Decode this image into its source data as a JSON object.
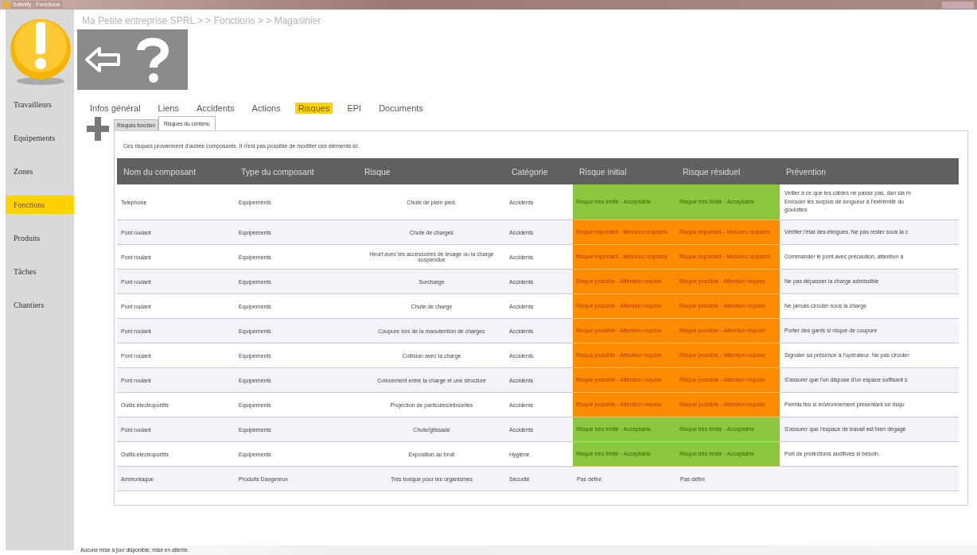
{
  "window": {
    "title": "Safetify : Fonctions"
  },
  "sidebar": {
    "items": [
      {
        "label": "Travailleurs",
        "selected": false
      },
      {
        "label": "Equipements",
        "selected": false
      },
      {
        "label": "Zones",
        "selected": false
      },
      {
        "label": "Fonctions",
        "selected": true
      },
      {
        "label": "Produits",
        "selected": false
      },
      {
        "label": "Tâches",
        "selected": false
      },
      {
        "label": "Chantiers",
        "selected": false
      }
    ]
  },
  "breadcrumb": "Ma Petite entreprise SPRL > > Fonctions > > Magasinier",
  "tabs": [
    {
      "label": "Infos général",
      "selected": false
    },
    {
      "label": "Liens",
      "selected": false
    },
    {
      "label": "Accidents",
      "selected": false
    },
    {
      "label": "Actions",
      "selected": false
    },
    {
      "label": "Risques",
      "selected": true
    },
    {
      "label": "EPI",
      "selected": false
    },
    {
      "label": "Documents",
      "selected": false
    }
  ],
  "subtabs": [
    {
      "label": "Risques fonction",
      "selected": false
    },
    {
      "label": "Risques du contenu",
      "selected": true
    }
  ],
  "note": "Ces risques proviennent d'autres composants. Il n'est pas possible de modifier ces éléments ici.",
  "table": {
    "columns": [
      "Nom du composant",
      "Type du composant",
      "Risque",
      "Catégorie",
      "Risque initial",
      "Risque résiduel",
      "Prévention"
    ],
    "rows": [
      {
        "name": "Telephone",
        "type": "Equipements",
        "risk": "Chute de plein pied.",
        "category": "Accidents",
        "initial": {
          "kind": "low",
          "text": "Risque très limité - Acceptable"
        },
        "residual": {
          "kind": "low",
          "text": "Risque très limité - Acceptable"
        },
        "prevention": "Veiller à ce que les câbles ne passe pas, dan sla m\nEnrouler les surplus de longueur à l'extrémité du\ngoulottes"
      },
      {
        "name": "Pont roulant",
        "type": "Equipements",
        "risk": "Chute de charges",
        "category": "Accidents",
        "initial": {
          "kind": "important",
          "text": "Risque important - Mesures requises"
        },
        "residual": {
          "kind": "important",
          "text": "Risque important - Mesures requises"
        },
        "prevention": "Vérifier l'état des élingues. Ne pas rester sous la c"
      },
      {
        "name": "Pont roulant",
        "type": "Equipements",
        "risk": "Heurt avec les accessoires de levage ou la charge suspendue",
        "category": "Accidents",
        "initial": {
          "kind": "important",
          "text": "Risque important - Mesures requises"
        },
        "residual": {
          "kind": "important",
          "text": "Risque important - Mesures requises"
        },
        "prevention": "Commander le pont avec précaution, attention a"
      },
      {
        "name": "Pont roulant",
        "type": "Equipements",
        "risk": "Surcharge",
        "category": "Accidents",
        "initial": {
          "kind": "possible",
          "text": "Risque possible - Attention requise"
        },
        "residual": {
          "kind": "possible",
          "text": "Risque possible - Attention requise"
        },
        "prevention": "Ne pas dépasser la charge admissible"
      },
      {
        "name": "Pont roulant",
        "type": "Equipements",
        "risk": "Chute de charge",
        "category": "Accidents",
        "initial": {
          "kind": "possible",
          "text": "Risque possible - Attention requise"
        },
        "residual": {
          "kind": "possible",
          "text": "Risque possible - Attention requise"
        },
        "prevention": "Ne jamais circuler sous la charge"
      },
      {
        "name": "Pont roulant",
        "type": "Equipements",
        "risk": "Coupure lors de la manutention de charges",
        "category": "Accidents",
        "initial": {
          "kind": "possible",
          "text": "Risque possible - Attention requise"
        },
        "residual": {
          "kind": "possible",
          "text": "Risque possible - Attention requise"
        },
        "prevention": "Porter des gants si risque de coupure"
      },
      {
        "name": "Pont roulant",
        "type": "Equipements",
        "risk": "Collision avec la charge",
        "category": "Accidents",
        "initial": {
          "kind": "possible",
          "text": "Risque possible - Attention requise"
        },
        "residual": {
          "kind": "possible",
          "text": "Risque possible - Attention requise"
        },
        "prevention": "Signaler sa présence à l'opérateur. Ne pas circuler"
      },
      {
        "name": "Pont roulant",
        "type": "Equipements",
        "risk": "Coincement entre la charge et une structure",
        "category": "Accidents",
        "initial": {
          "kind": "possible",
          "text": "Risque possible - Attention requise"
        },
        "residual": {
          "kind": "possible",
          "text": "Risque possible - Attention requise"
        },
        "prevention": "S'assurer que l'on dispose d'un espace suffisant s"
      },
      {
        "name": "Outils électroportifs",
        "type": "Equipements",
        "risk": "Projection de particules/étincelles",
        "category": "Accidents",
        "initial": {
          "kind": "possible",
          "text": "Risque possible - Attention requise"
        },
        "residual": {
          "kind": "possible",
          "text": "Risque possible - Attention requise"
        },
        "prevention": "Permis feu si environnement présentant un risqu"
      },
      {
        "name": "Pont roulant",
        "type": "Equipements",
        "risk": "Chute/glissade",
        "category": "Accidents",
        "initial": {
          "kind": "low",
          "text": "Risque très limité - Acceptable"
        },
        "residual": {
          "kind": "low",
          "text": "Risque très limité - Acceptable"
        },
        "prevention": "S'assurer que l'espace de travail est bien dégagé"
      },
      {
        "name": "Outils électroportifs",
        "type": "Equipements",
        "risk": "Exposition au bruit",
        "category": "Hygiène",
        "initial": {
          "kind": "low",
          "text": "Risque très limité - Acceptable"
        },
        "residual": {
          "kind": "low",
          "text": "Risque très limité - Acceptable"
        },
        "prevention": "Port de protections auditives si besoin."
      },
      {
        "name": "Ammoniaque",
        "type": "Produits Dangereux",
        "risk": "Très toxique pour les organismes",
        "category": "Sécurité",
        "initial": {
          "kind": "undefined",
          "text": "Pas défini"
        },
        "residual": {
          "kind": "undefined",
          "text": "Pas défini"
        },
        "prevention": ""
      }
    ]
  },
  "status_bar": "Aucune mise à jour disponible, mise en attente."
}
